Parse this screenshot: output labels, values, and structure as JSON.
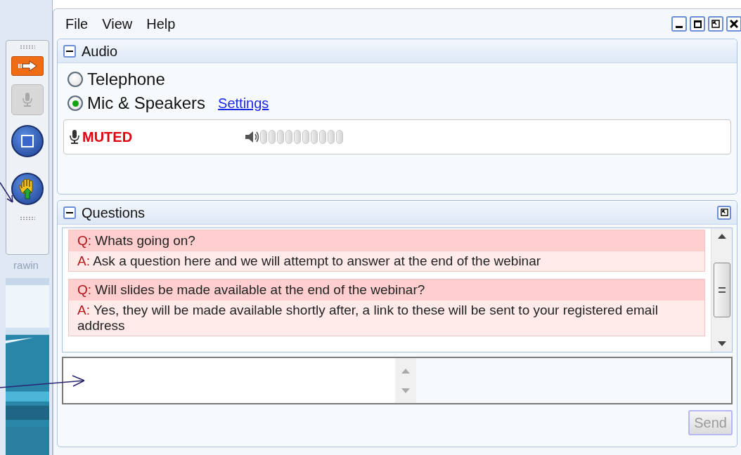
{
  "toolbar": {
    "label": "rawin",
    "mic_disabled": true
  },
  "menu": [
    "File",
    "View",
    "Help"
  ],
  "audio": {
    "title": "Audio",
    "expanded": true,
    "options": [
      {
        "label": "Telephone",
        "selected": false
      },
      {
        "label": "Mic & Speakers",
        "selected": true
      }
    ],
    "settings_link": "Settings",
    "mic_status": "MUTED",
    "muted": true,
    "volume": {
      "level": 0
    }
  },
  "questions": {
    "title": "Questions",
    "expanded": true,
    "items": [
      {
        "q_prefix": "Q:",
        "question": "Whats going on?",
        "a_prefix": "A:",
        "answer": "Ask a question here and we will attempt to answer at the end of the webinar"
      },
      {
        "q_prefix": "Q:",
        "question": "Will slides be made available at the end of the webinar?",
        "a_prefix": "A:",
        "answer": "Yes, they will be made available shortly after, a link to these will be sent to your registered email address"
      }
    ],
    "send": {
      "label": "Send",
      "disabled": true
    }
  }
}
